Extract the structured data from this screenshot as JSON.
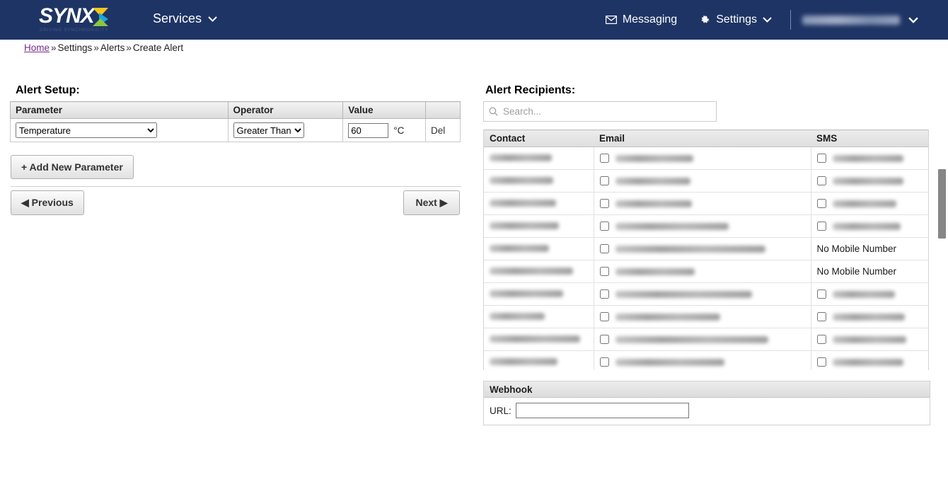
{
  "header": {
    "logo_text": "SYNX",
    "logo_tagline": "DRIVING SYNCHRONICITY",
    "services_label": "Services",
    "messaging_label": "Messaging",
    "settings_label": "Settings",
    "user_label": "",
    "navy": "#1e3464"
  },
  "breadcrumb": {
    "home": "Home",
    "sep": "»",
    "settings": "Settings",
    "alerts": "Alerts",
    "current": "Create Alert"
  },
  "alert_setup": {
    "title": "Alert Setup:",
    "columns": [
      "Parameter",
      "Operator",
      "Value",
      ""
    ],
    "rows": [
      {
        "parameter": "Temperature",
        "parameter_options": [
          "Temperature"
        ],
        "operator": "Greater Than",
        "operator_options": [
          "Greater Than"
        ],
        "value": "60",
        "unit": "°C",
        "delete_label": "Del"
      }
    ],
    "add_parameter_label": "+ Add New Parameter",
    "previous_label": "◀ Previous",
    "next_label": "Next ▶"
  },
  "recipients": {
    "title": "Alert Recipients:",
    "search_placeholder": "Search...",
    "search_value": "",
    "columns": [
      "Contact",
      "Email",
      "SMS"
    ],
    "no_mobile_label": "No Mobile Number",
    "rows": [
      {
        "contact_w": 88,
        "email_w": 110,
        "email_checked": false,
        "sms_type": "number",
        "sms_w": 100,
        "sms_checked": false
      },
      {
        "contact_w": 90,
        "email_w": 106,
        "email_checked": false,
        "sms_type": "number",
        "sms_w": 100,
        "sms_checked": false
      },
      {
        "contact_w": 94,
        "email_w": 108,
        "email_checked": false,
        "sms_type": "number",
        "sms_w": 90,
        "sms_checked": false
      },
      {
        "contact_w": 98,
        "email_w": 160,
        "email_checked": false,
        "sms_type": "number",
        "sms_w": 96,
        "sms_checked": false
      },
      {
        "contact_w": 84,
        "email_w": 212,
        "email_checked": false,
        "sms_type": "none"
      },
      {
        "contact_w": 118,
        "email_w": 112,
        "email_checked": false,
        "sms_type": "none"
      },
      {
        "contact_w": 104,
        "email_w": 193,
        "email_checked": false,
        "sms_type": "number",
        "sms_w": 88,
        "sms_checked": false
      },
      {
        "contact_w": 78,
        "email_w": 148,
        "email_checked": false,
        "sms_type": "number",
        "sms_w": 102,
        "sms_checked": false
      },
      {
        "contact_w": 128,
        "email_w": 216,
        "email_checked": false,
        "sms_type": "number",
        "sms_w": 104,
        "sms_checked": false
      },
      {
        "contact_w": 96,
        "email_w": 154,
        "email_checked": false,
        "sms_type": "number",
        "sms_w": 100,
        "sms_checked": false
      }
    ]
  },
  "webhook": {
    "title": "Webhook",
    "url_label": "URL:",
    "url_value": ""
  },
  "icons": {
    "envelope": "envelope-icon",
    "gear": "gear-icon",
    "chevron": "chevron-down-icon",
    "search": "search-icon"
  }
}
